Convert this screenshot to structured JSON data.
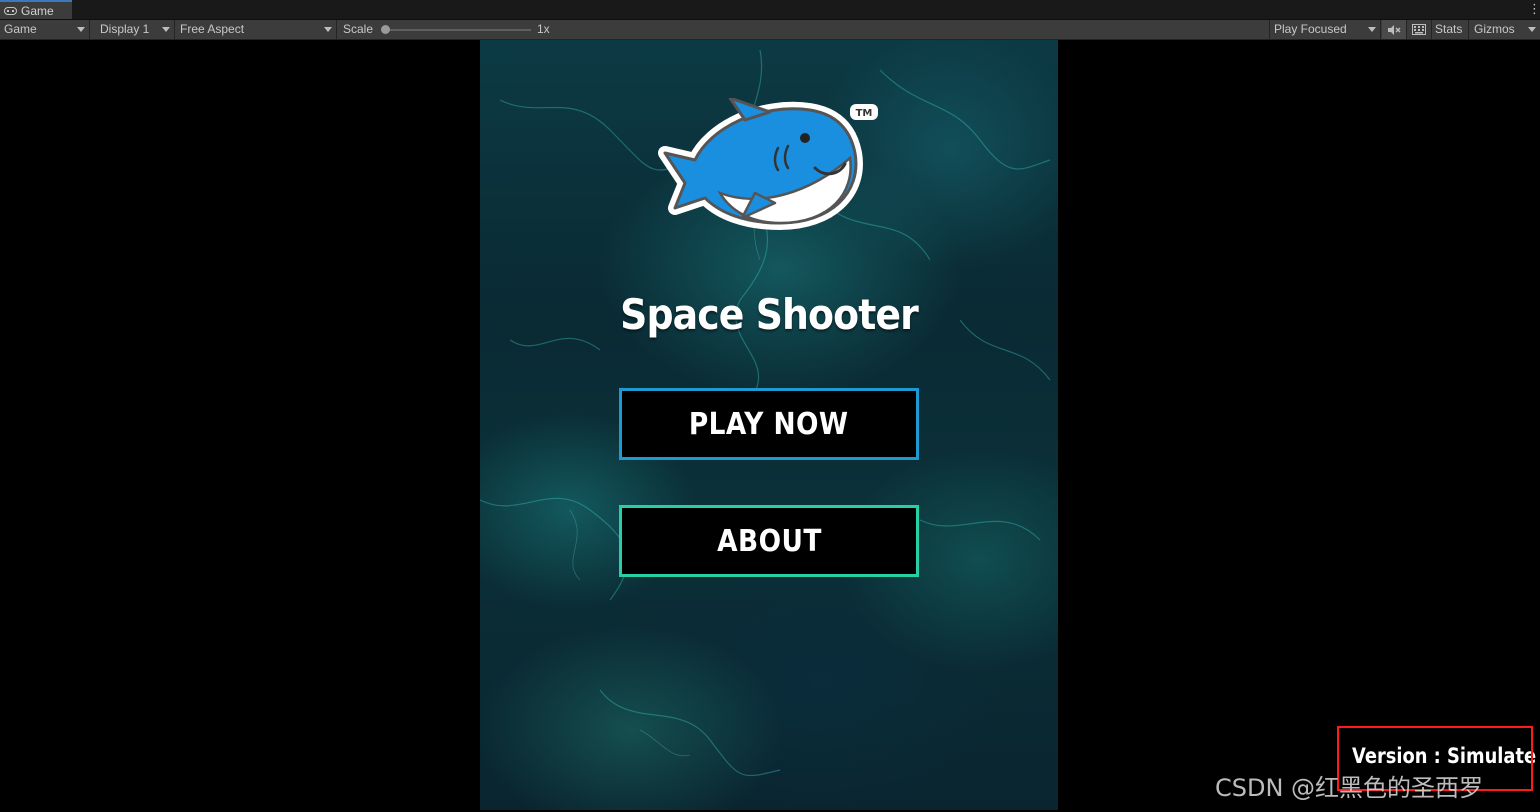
{
  "tab": {
    "label": "Game",
    "icon": "gamepad-icon"
  },
  "toolbar": {
    "mode": "Game",
    "display": "Display 1",
    "aspect": "Free Aspect",
    "scale_label": "Scale",
    "scale_value": "1x",
    "scale_slider_fraction": 0.0,
    "play_mode": "Play Focused",
    "mute_icon": "mute-audio-icon",
    "keyboard_icon": "keyboard-shortcuts-icon",
    "stats": "Stats",
    "gizmos": "Gizmos"
  },
  "game": {
    "logo_icon": "shark-logo",
    "logo_trademark": "TM",
    "title": "Space Shooter",
    "play_button": "PLAY NOW",
    "about_button": "ABOUT"
  },
  "version_label": "Version : Simulate",
  "watermark": "CSDN @红黑色的圣西罗",
  "colors": {
    "play_border": "#1e9ad2",
    "about_border": "#27cfa5",
    "highlight_box": "#ff1a1a",
    "shark_blue": "#1a8fe0"
  }
}
